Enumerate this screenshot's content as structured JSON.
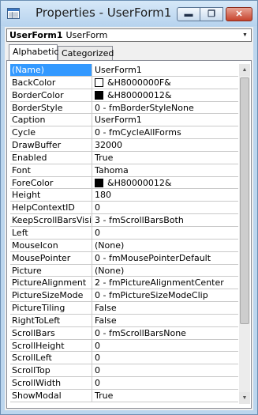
{
  "window": {
    "title": "Properties - UserForm1"
  },
  "controls": {
    "minimize": "▬",
    "maximize": "❐",
    "close": "✕"
  },
  "object_selector": {
    "name": "UserForm1",
    "type": "UserForm"
  },
  "tabs": [
    {
      "label": "Alphabetic",
      "active": true
    },
    {
      "label": "Categorized",
      "active": false
    }
  ],
  "properties": [
    {
      "name": "(Name)",
      "value": "UserForm1",
      "selected": true
    },
    {
      "name": "BackColor",
      "value": "&H8000000F&",
      "swatch": "#ffffff"
    },
    {
      "name": "BorderColor",
      "value": "&H80000012&",
      "swatch": "#000000"
    },
    {
      "name": "BorderStyle",
      "value": "0 - fmBorderStyleNone"
    },
    {
      "name": "Caption",
      "value": "UserForm1"
    },
    {
      "name": "Cycle",
      "value": "0 - fmCycleAllForms"
    },
    {
      "name": "DrawBuffer",
      "value": "32000"
    },
    {
      "name": "Enabled",
      "value": "True"
    },
    {
      "name": "Font",
      "value": "Tahoma"
    },
    {
      "name": "ForeColor",
      "value": "&H80000012&",
      "swatch": "#000000"
    },
    {
      "name": "Height",
      "value": "180"
    },
    {
      "name": "HelpContextID",
      "value": "0"
    },
    {
      "name": "KeepScrollBarsVisible",
      "value": "3 - fmScrollBarsBoth"
    },
    {
      "name": "Left",
      "value": "0"
    },
    {
      "name": "MouseIcon",
      "value": "(None)"
    },
    {
      "name": "MousePointer",
      "value": "0 - fmMousePointerDefault"
    },
    {
      "name": "Picture",
      "value": "(None)"
    },
    {
      "name": "PictureAlignment",
      "value": "2 - fmPictureAlignmentCenter"
    },
    {
      "name": "PictureSizeMode",
      "value": "0 - fmPictureSizeModeClip"
    },
    {
      "name": "PictureTiling",
      "value": "False"
    },
    {
      "name": "RightToLeft",
      "value": "False"
    },
    {
      "name": "ScrollBars",
      "value": "0 - fmScrollBarsNone"
    },
    {
      "name": "ScrollHeight",
      "value": "0"
    },
    {
      "name": "ScrollLeft",
      "value": "0"
    },
    {
      "name": "ScrollTop",
      "value": "0"
    },
    {
      "name": "ScrollWidth",
      "value": "0"
    },
    {
      "name": "ShowModal",
      "value": "True"
    }
  ],
  "scrollbar": {
    "up_icon": "▲",
    "down_icon": "▼"
  }
}
